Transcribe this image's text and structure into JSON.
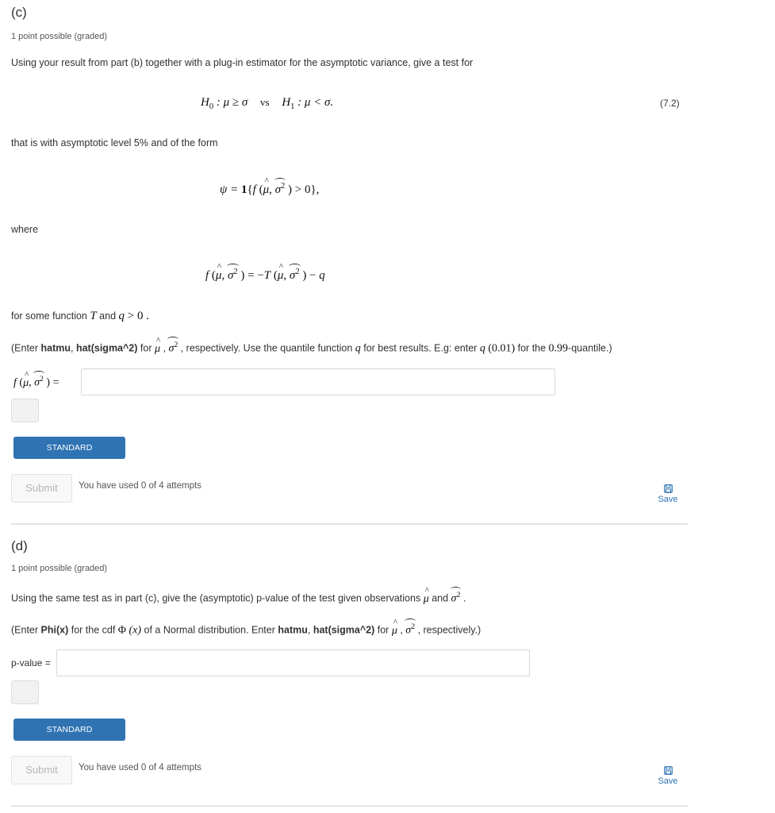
{
  "part_c": {
    "heading": "(c)",
    "points": "1 point possible (graded)",
    "intro": "Using your result from part (b) together with a plug-in estimator for the asymptotic variance, give a test for",
    "hypothesis": {
      "h0": "H",
      "h0_sub": "0",
      "h0_rel": " : μ ≥ σ",
      "vs": "vs",
      "h1": "H",
      "h1_sub": "1",
      "h1_rel": " : μ < σ.",
      "eq_number": "(7.2)"
    },
    "level_text": "that is with asymptotic level 5% and of the form",
    "psi_formula": {
      "lhs": "ψ = ",
      "indicator": "1",
      "open": "{",
      "f": "f",
      "args_open": " (",
      "mu": "μ",
      "comma": ", ",
      "sigma": "σ",
      "sq": "2",
      "args_close": " ) > 0},"
    },
    "where_text": "where",
    "f_formula": {
      "f": "f",
      "open": " (",
      "mu": "μ",
      "comma": ", ",
      "sigma": "σ",
      "sq": "2",
      "close": " ) = −",
      "T": "T",
      "open2": " (",
      "close2": " ) − ",
      "q": "q"
    },
    "function_text_pre": "for some function ",
    "function_T": "T",
    "function_and": " and ",
    "function_q": "q",
    "function_rest": " > 0 .",
    "instructions": {
      "pre": "(Enter ",
      "b1": "hatmu",
      "sep": ", ",
      "b2": "hat(sigma^2)",
      "for": " for ",
      "mu": "μ",
      "comma": " , ",
      "sigma": "σ",
      "sq": "2",
      "mid": " , respectively. Use the quantile function ",
      "q": "q",
      "mid2": " for best results. E.g: enter ",
      "q2": "q",
      "example": " (0.01)",
      "for_the": " for the ",
      "quantile": "0.99",
      "end": "-quantile.)"
    },
    "answer_label": {
      "f": "f",
      "open": " (",
      "mu": "μ",
      "comma": ", ",
      "sigma": "σ",
      "sq": "2",
      "close": " ) ="
    },
    "answer_value": "",
    "standard_notation": "STANDARD NOTATION",
    "submit": "Submit",
    "attempts": "You have used 0 of 4 attempts",
    "save": "Save"
  },
  "part_d": {
    "heading": "(d)",
    "points": "1 point possible (graded)",
    "intro_pre": "Using the same test as in part (c), give the (asymptotic) p-value of the test given observations ",
    "intro_mu": "μ",
    "intro_and": " and ",
    "intro_sigma": "σ",
    "intro_sq": "2",
    "intro_end": " .",
    "instructions": {
      "pre": "(Enter ",
      "b0": "Phi(x)",
      "mid0": " for the cdf ",
      "Phi": "Φ",
      "x": " (x)",
      "mid1": " of a Normal distribution. Enter ",
      "b1": "hatmu",
      "sep": ", ",
      "b2": "hat(sigma^2)",
      "for": " for ",
      "mu": "μ",
      "comma": " , ",
      "sigma": "σ",
      "sq": "2",
      "end": " , respectively.)"
    },
    "answer_label": "p-value =",
    "answer_value": "",
    "standard_notation": "STANDARD NOTATION",
    "submit": "Submit",
    "attempts": "You have used 0 of 4 attempts",
    "save": "Save"
  },
  "colors": {
    "accent": "#2f73b3",
    "text": "#313131",
    "divider": "#e4e4e4"
  }
}
